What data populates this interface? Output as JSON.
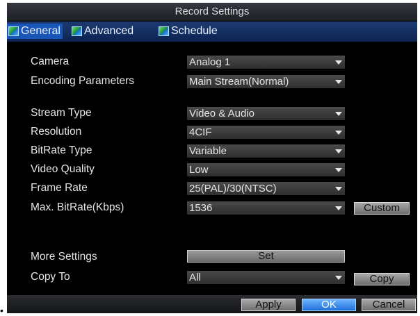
{
  "window": {
    "title": "Record Settings"
  },
  "tabs": [
    {
      "label": "General",
      "icon": "tab-icon",
      "active": true
    },
    {
      "label": "Advanced",
      "icon": "tab-icon",
      "active": false
    },
    {
      "label": "Schedule",
      "icon": "tab-icon",
      "active": false
    }
  ],
  "fields": {
    "camera": {
      "label": "Camera",
      "value": "Analog 1"
    },
    "encoding": {
      "label": "Encoding Parameters",
      "value": "Main Stream(Normal)"
    },
    "stream_type": {
      "label": "Stream Type",
      "value": "Video & Audio"
    },
    "resolution": {
      "label": "Resolution",
      "value": "4CIF"
    },
    "bitrate_type": {
      "label": "BitRate Type",
      "value": "Variable"
    },
    "video_quality": {
      "label": "Video Quality",
      "value": "Low"
    },
    "frame_rate": {
      "label": "Frame Rate",
      "value": "25(PAL)/30(NTSC)"
    },
    "max_bitrate": {
      "label": "Max. BitRate(Kbps)",
      "value": "1536",
      "custom_label": "Custom"
    },
    "more_settings": {
      "label": "More Settings",
      "button_label": "Set"
    },
    "copy_to": {
      "label": "Copy To",
      "value": "All",
      "copy_label": "Copy"
    }
  },
  "footer": {
    "apply_label": "Apply",
    "ok_label": "OK",
    "cancel_label": "Cancel"
  },
  "page_marker": "•",
  "colors": {
    "tab_bar": "#0c2352",
    "active_tab": "#1a56b8",
    "ok_button": "#1f6fd8"
  }
}
